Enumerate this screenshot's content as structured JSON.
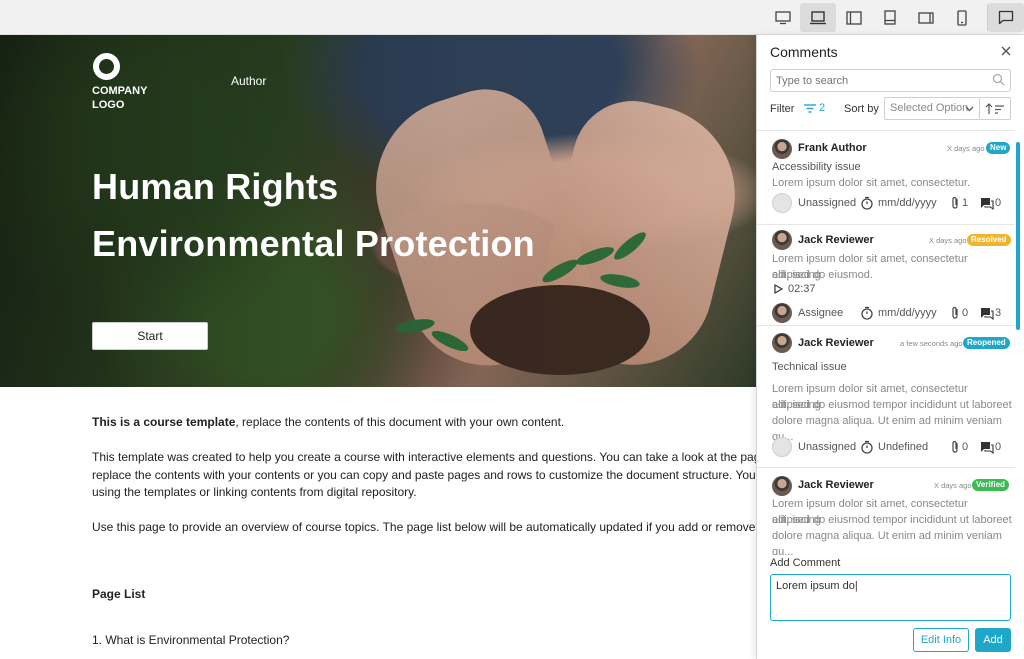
{
  "toolbar": {
    "buttons": [
      {
        "icon": "desktop-icon",
        "active": false
      },
      {
        "icon": "laptop-icon",
        "active": true
      },
      {
        "icon": "tablet-landscape-icon",
        "active": false
      },
      {
        "icon": "tablet-portrait-icon",
        "active": false
      },
      {
        "icon": "phone-landscape-icon",
        "active": false
      },
      {
        "icon": "phone-portrait-icon",
        "active": false
      },
      {
        "icon": "comments-icon",
        "active": true
      }
    ]
  },
  "hero": {
    "logo_text": "COMPANY LOGO",
    "nav_author": "Author",
    "title_line1": "Human Rights",
    "title_line2": "Environmental Protection",
    "start_label": "Start"
  },
  "doc": {
    "intro_bold": "This is a course template",
    "intro_rest": ", replace the contents of this document with your own content.",
    "para2_line1": "This template was created to help you create a course with interactive elements and questions. You can take a look at the pages",
    "para2_line2": "replace the contents with your contents or you can copy and paste pages and rows to customize the document structure. You ca",
    "para2_line3": "using the templates or linking contents from digital repository.",
    "para3": "Use this page to provide an overview of course topics. The page list below will be automatically updated if you add or remove a p",
    "page_list_heading": "Page List",
    "page_list_item1": "1. What is Environmental Protection?"
  },
  "comments": {
    "title": "Comments",
    "search_placeholder": "Type to search",
    "filter_label": "Filter",
    "filter_count": "2",
    "sort_label": "Sort by",
    "sort_value": "Selected Option",
    "items": [
      {
        "author": "Frank Author",
        "time": "X days ago",
        "badge": "New",
        "title": "Accessibility issue",
        "body": "Lorem ipsum dolor sit amet, consectetur.",
        "assignee": "Unassigned",
        "due": "mm/dd/yyyy",
        "attachments": "1",
        "replies": "0"
      },
      {
        "author": "Jack Reviewer",
        "time": "X days ago",
        "badge": "Resolved",
        "body_line1": "Lorem ipsum dolor sit amet, consectetur adipiscing",
        "body_line2": "elit, sed do eiusmod.",
        "audio": "02:37",
        "assignee": "Assignee",
        "due": "mm/dd/yyyy",
        "attachments": "0",
        "replies": "3"
      },
      {
        "author": "Jack Reviewer",
        "time": "a few seconds ago",
        "badge": "Reopened",
        "title": "Technical issue",
        "body_line1": "Lorem ipsum dolor sit amet, consectetur adipiscing",
        "body_line2": "elit, sed do eiusmod tempor incididunt ut laboreet",
        "body_line3": "dolore magna aliqua. Ut enim ad minim veniam qu...",
        "assignee": "Unassigned",
        "due": "Undefined",
        "attachments": "0",
        "replies": "0"
      },
      {
        "author": "Jack Reviewer",
        "time": "X days ago",
        "badge": "Verified",
        "body_line1": "Lorem ipsum dolor sit amet, consectetur adipiscing",
        "body_line2": "elit, sed do eiusmod tempor incididunt ut laboreet",
        "body_line3": "dolore magna aliqua. Ut enim ad minim veniam qu..."
      }
    ],
    "add_label": "Add Comment",
    "add_value": "Lorem ipsum do|",
    "edit_info_label": "Edit Info",
    "add_button_label": "Add"
  },
  "colors": {
    "accent": "#1fa7c9",
    "badge_new": "#1fa7c9",
    "badge_resolved": "#f0b52a",
    "badge_reopened": "#1fa7c9",
    "badge_verified": "#3cba54"
  }
}
